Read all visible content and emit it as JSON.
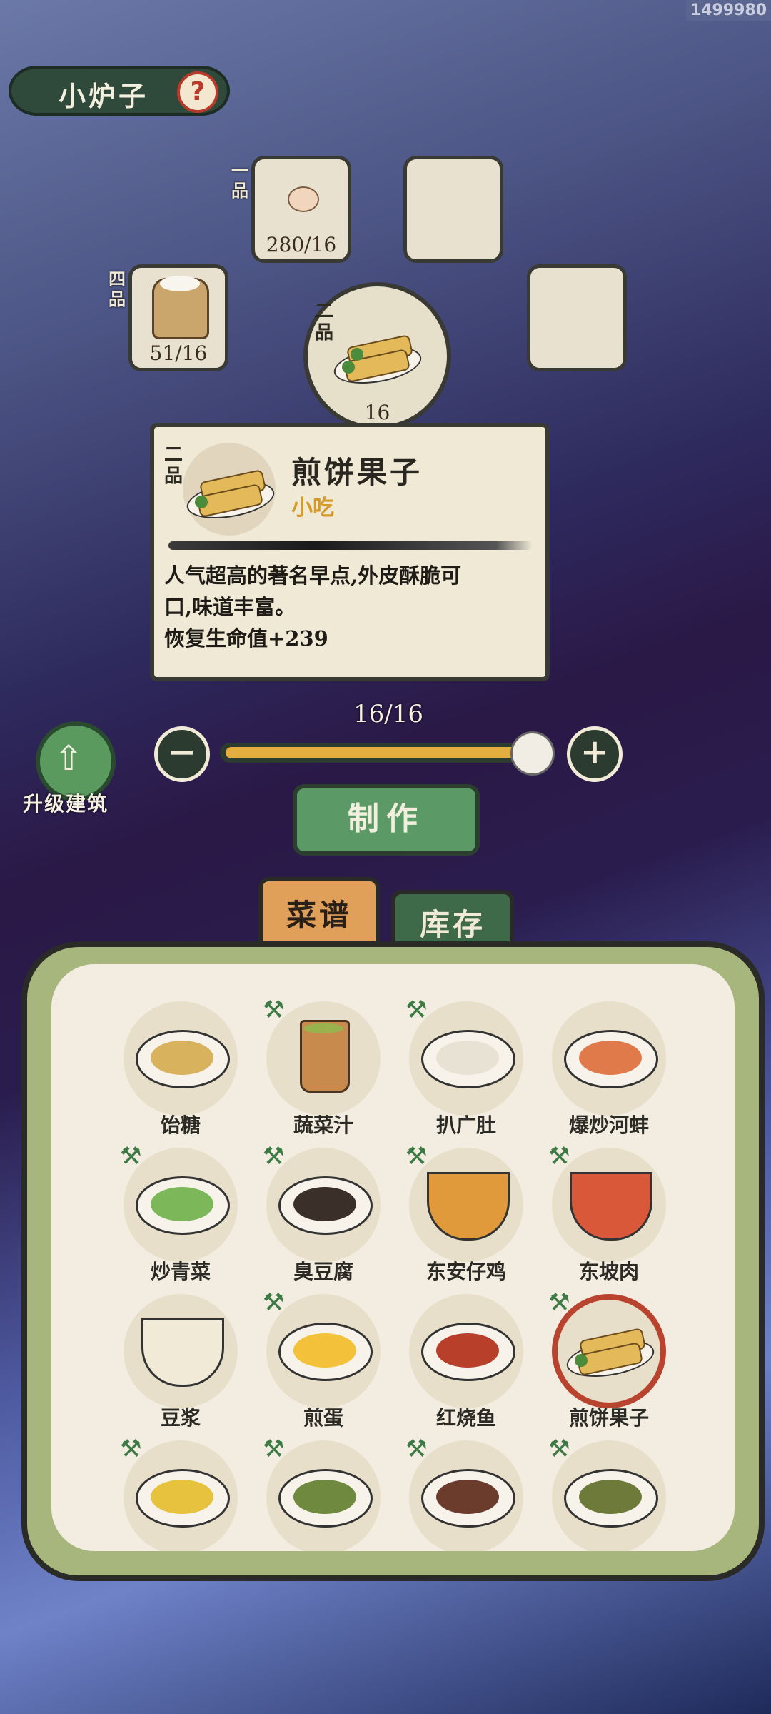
{
  "uid": "1499980",
  "header": {
    "title": "小炉子",
    "help_icon": "?"
  },
  "slots": [
    {
      "grade": "一品",
      "count": "280/16",
      "icon": "egg-icon"
    },
    {
      "grade": "",
      "count": "",
      "icon": ""
    },
    {
      "grade": "四品",
      "count": "51/16",
      "icon": "flour-sack-icon"
    },
    {
      "grade": "",
      "count": "",
      "icon": ""
    }
  ],
  "center": {
    "grade": "二品",
    "count": "16",
    "icon": "jianbing-icon"
  },
  "card": {
    "grade": "二品",
    "name": "煎饼果子",
    "category": "小吃",
    "desc1": "人气超高的著名早点,外皮酥脆可",
    "desc2": "口,味道丰富。",
    "effect": "恢复生命值+239"
  },
  "slider": {
    "label": "16/16",
    "value": 16,
    "max": 16,
    "minus": "−",
    "plus": "+"
  },
  "upgrade": {
    "label": "升级建筑",
    "icon": "building-upgrade-icon"
  },
  "make_button": "制作",
  "tabs": {
    "recipes": "菜谱",
    "stock": "库存"
  },
  "recipes": [
    {
      "label": "饴糖",
      "unlocked": false
    },
    {
      "label": "蔬菜汁",
      "unlocked": true
    },
    {
      "label": "扒广肚",
      "unlocked": true
    },
    {
      "label": "爆炒河蚌",
      "unlocked": false
    },
    {
      "label": "炒青菜",
      "unlocked": true
    },
    {
      "label": "臭豆腐",
      "unlocked": true
    },
    {
      "label": "东安仔鸡",
      "unlocked": true
    },
    {
      "label": "东坡肉",
      "unlocked": true
    },
    {
      "label": "豆浆",
      "unlocked": false
    },
    {
      "label": "煎蛋",
      "unlocked": true
    },
    {
      "label": "红烧鱼",
      "unlocked": false
    },
    {
      "label": "煎饼果子",
      "unlocked": true,
      "selected": true
    },
    {
      "label": "",
      "unlocked": true
    },
    {
      "label": "",
      "unlocked": true
    },
    {
      "label": "",
      "unlocked": true
    },
    {
      "label": "",
      "unlocked": true
    }
  ],
  "colors": {
    "accent_green": "#5b9a66",
    "slider_fill": "#e3ad40",
    "category_orange": "#d49a2a"
  }
}
